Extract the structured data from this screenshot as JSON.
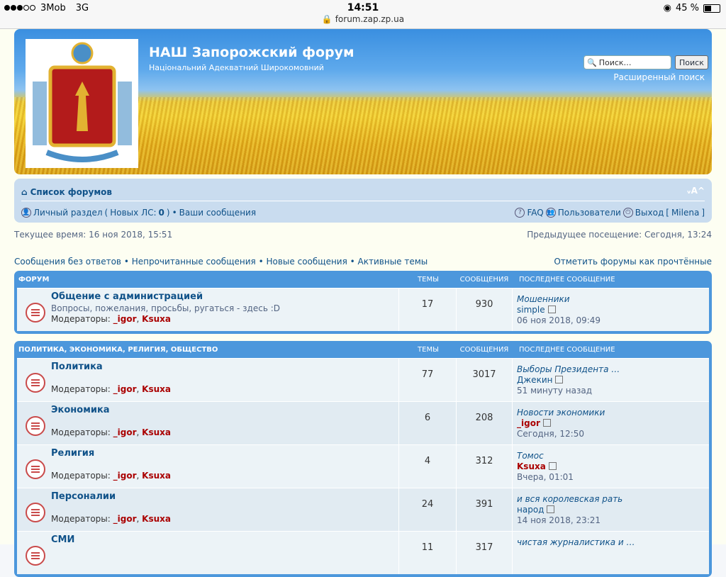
{
  "statusbar": {
    "carrier": "3Mob",
    "network": "3G",
    "time": "14:51",
    "url": "forum.zap.zp.ua",
    "battery": "45 %",
    "battery_level": 0.45
  },
  "header": {
    "title": "НАШ Запорожский форум",
    "subtitle": "Національний Адекватний Широкомовний",
    "search_placeholder": "Поиск…",
    "search_button": "Поиск",
    "advanced_search": "Расширенный поиск"
  },
  "nav": {
    "forum_list": "Список форумов",
    "font_size": "ᵥA^",
    "personal": "Личный раздел",
    "new_pm_label": "Новых ЛС:",
    "new_pm_count": "0",
    "your_posts": "Ваши сообщения",
    "faq": "FAQ",
    "users": "Пользователи",
    "logout": "Выход",
    "username": "Milena"
  },
  "time": {
    "current": "Текущее время: 16 ноя 2018, 15:51",
    "previous": "Предыдущее посещение: Сегодня, 13:24"
  },
  "links": {
    "unanswered": "Сообщения без ответов",
    "unread": "Непрочитанные сообщения",
    "new": "Новые сообщения",
    "active": "Активные темы",
    "mark_read": "Отметить форумы как прочтённые"
  },
  "columns": {
    "topics": "ТЕМЫ",
    "posts": "СООБЩЕНИЯ",
    "last_post": "ПОСЛЕДНЕЕ СООБЩЕНИЕ"
  },
  "sections": [
    {
      "title": "ФОРУМ",
      "forums": [
        {
          "name": "Общение с администрацией",
          "desc": "Вопросы, пожелания, просьбы, ругаться - здесь :D",
          "mods_label": "Модераторы:",
          "mod1": "_igor",
          "mod2": "Ksuxa",
          "topics": "17",
          "posts": "930",
          "lp_title": "Мошенники",
          "lp_user": "simple",
          "lp_date": "06 ноя 2018, 09:49"
        }
      ]
    },
    {
      "title": "ПОЛИТИКА, ЭКОНОМИКА, РЕЛИГИЯ, ОБЩЕСТВО",
      "forums": [
        {
          "name": "Политика",
          "mods_label": "Модераторы:",
          "mod1": "_igor",
          "mod2": "Ksuxa",
          "topics": "77",
          "posts": "3017",
          "lp_title": "Выборы Президента …",
          "lp_user": "Джекин",
          "lp_date": "51 минуту назад"
        },
        {
          "name": "Экономика",
          "mods_label": "Модераторы:",
          "mod1": "_igor",
          "mod2": "Ksuxa",
          "topics": "6",
          "posts": "208",
          "lp_title": "Новости экономики",
          "lp_user": "_igor",
          "lp_date": "Сегодня, 12:50"
        },
        {
          "name": "Религия",
          "mods_label": "Модераторы:",
          "mod1": "_igor",
          "mod2": "Ksuxa",
          "topics": "4",
          "posts": "312",
          "lp_title": "Томос",
          "lp_user": "Ksuxa",
          "lp_date": "Вчера, 01:01"
        },
        {
          "name": "Персоналии",
          "mods_label": "Модераторы:",
          "mod1": "_igor",
          "mod2": "Ksuxa",
          "topics": "24",
          "posts": "391",
          "lp_title": "и вся королевская рать",
          "lp_user": "народ",
          "lp_date": "14 ноя 2018, 23:21"
        },
        {
          "name": "СМИ",
          "topics": "11",
          "posts": "317",
          "lp_title": "чистая журналистика и …"
        }
      ]
    }
  ]
}
